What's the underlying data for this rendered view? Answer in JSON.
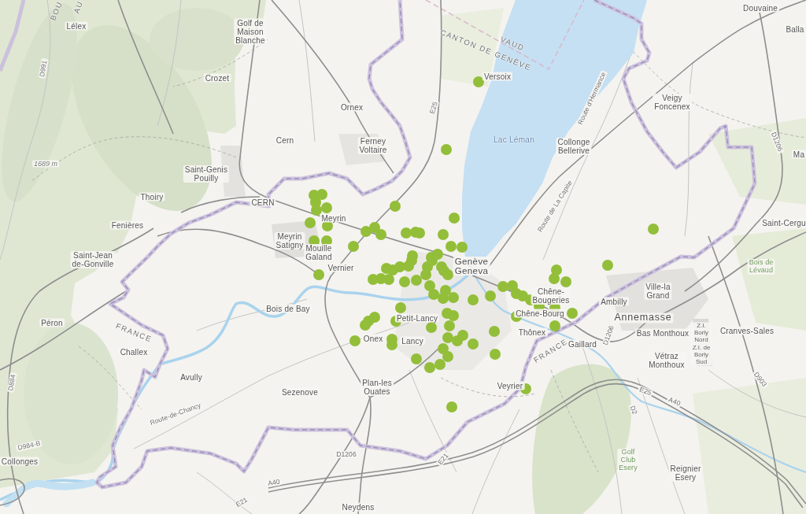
{
  "map": {
    "labels": [
      {
        "kind": "region",
        "lines": [
          "BOU"
        ]
      },
      {
        "kind": "region",
        "lines": [
          "AU"
        ]
      },
      {
        "kind": "place",
        "lines": [
          "Douvaine"
        ]
      },
      {
        "kind": "place",
        "lines": [
          "Lélex"
        ]
      },
      {
        "kind": "place",
        "lines": [
          "Golf de",
          "Maison",
          "Blanche"
        ]
      },
      {
        "kind": "place",
        "lines": [
          "Balla"
        ]
      },
      {
        "kind": "region",
        "lines": [
          "CANTON DE GENÈVE"
        ]
      },
      {
        "kind": "region",
        "lines": [
          "VAUD"
        ]
      },
      {
        "kind": "road",
        "lines": [
          "D991"
        ]
      },
      {
        "kind": "place",
        "lines": [
          "Crozet"
        ]
      },
      {
        "kind": "place",
        "lines": [
          "Versoix"
        ]
      },
      {
        "kind": "place",
        "lines": [
          "Ornex"
        ]
      },
      {
        "kind": "road",
        "lines": [
          "E25"
        ]
      },
      {
        "kind": "road",
        "lines": [
          "Route d'Hermance"
        ]
      },
      {
        "kind": "place",
        "lines": [
          "Veigy",
          "Foncenex"
        ]
      },
      {
        "kind": "place",
        "lines": [
          "Cern"
        ]
      },
      {
        "kind": "place",
        "lines": [
          "Ferney",
          "Voltaire"
        ]
      },
      {
        "kind": "water",
        "lines": [
          "Lac Léman"
        ]
      },
      {
        "kind": "place",
        "lines": [
          "Collonge",
          "Bellerive"
        ]
      },
      {
        "kind": "road",
        "lines": [
          "D1206"
        ]
      },
      {
        "kind": "place",
        "lines": [
          "Ma"
        ]
      },
      {
        "kind": "elevation",
        "lines": [
          "1689 m"
        ]
      },
      {
        "kind": "place",
        "lines": [
          "Saint-Genis",
          "Pouilly"
        ]
      },
      {
        "kind": "place",
        "lines": [
          "Thoiry"
        ]
      },
      {
        "kind": "place",
        "lines": [
          "CERN"
        ]
      },
      {
        "kind": "road",
        "lines": [
          "Route de La Capite"
        ]
      },
      {
        "kind": "place",
        "lines": [
          "Fenières"
        ]
      },
      {
        "kind": "place",
        "lines": [
          "Meyrin"
        ]
      },
      {
        "kind": "place",
        "lines": [
          "Saint-Cergu"
        ]
      },
      {
        "kind": "place",
        "lines": [
          "Meyrin",
          "Satigny"
        ]
      },
      {
        "kind": "place",
        "lines": [
          "Mouille",
          "Galand"
        ]
      },
      {
        "kind": "place",
        "lines": [
          "Saint-Jean",
          "de-Gonville"
        ]
      },
      {
        "kind": "place",
        "lines": [
          "Vernier"
        ]
      },
      {
        "kind": "town",
        "lines": [
          "Genève",
          "Geneva"
        ]
      },
      {
        "kind": "park",
        "lines": [
          "Bois de",
          "Lévaud"
        ]
      },
      {
        "kind": "place",
        "lines": [
          "Chêne-",
          "Bougeries"
        ]
      },
      {
        "kind": "place",
        "lines": [
          "Ambilly"
        ]
      },
      {
        "kind": "place",
        "lines": [
          "Ville-la",
          "Grand"
        ]
      },
      {
        "kind": "place",
        "lines": [
          "Péron"
        ]
      },
      {
        "kind": "place",
        "lines": [
          "Bois de Bay"
        ]
      },
      {
        "kind": "place",
        "lines": [
          "Petit-Lancy"
        ]
      },
      {
        "kind": "place",
        "lines": [
          "Chêne-Bourg"
        ]
      },
      {
        "kind": "city",
        "lines": [
          "Annemasse"
        ]
      },
      {
        "kind": "region",
        "lines": [
          "FRANCE"
        ]
      },
      {
        "kind": "place",
        "lines": [
          "Onex"
        ]
      },
      {
        "kind": "place",
        "lines": [
          "Lancy"
        ]
      },
      {
        "kind": "place",
        "lines": [
          "Thônex"
        ]
      },
      {
        "kind": "place",
        "lines": [
          "Gaillard"
        ]
      },
      {
        "kind": "road",
        "lines": [
          "D1206"
        ]
      },
      {
        "kind": "place",
        "lines": [
          "Bas Monthoux"
        ]
      },
      {
        "kind": "small",
        "lines": [
          "Z.I.",
          "Borly",
          "Nord",
          "Z.I. de",
          "Borly",
          "Sud"
        ]
      },
      {
        "kind": "place",
        "lines": [
          "Cranves-Sales"
        ]
      },
      {
        "kind": "place",
        "lines": [
          "Challex"
        ]
      },
      {
        "kind": "region",
        "lines": [
          "FRANCE"
        ]
      },
      {
        "kind": "place",
        "lines": [
          "Vétraz",
          "Monthoux"
        ]
      },
      {
        "kind": "road",
        "lines": [
          "D884"
        ]
      },
      {
        "kind": "place",
        "lines": [
          "Avully"
        ]
      },
      {
        "kind": "place",
        "lines": [
          "Sezenove"
        ]
      },
      {
        "kind": "place",
        "lines": [
          "Plan-les",
          "Ouates"
        ]
      },
      {
        "kind": "place",
        "lines": [
          "Veyrier"
        ]
      },
      {
        "kind": "road",
        "lines": [
          "E25"
        ]
      },
      {
        "kind": "road",
        "lines": [
          "D903"
        ]
      },
      {
        "kind": "road",
        "lines": [
          "Route-de-Chancy"
        ]
      },
      {
        "kind": "road",
        "lines": [
          "D2"
        ]
      },
      {
        "kind": "road",
        "lines": [
          "A40"
        ]
      },
      {
        "kind": "road",
        "lines": [
          "D984-B"
        ]
      },
      {
        "kind": "place",
        "lines": [
          "Collonges"
        ]
      },
      {
        "kind": "road",
        "lines": [
          "D1206"
        ]
      },
      {
        "kind": "road",
        "lines": [
          "E21"
        ]
      },
      {
        "kind": "park",
        "lines": [
          "Golf",
          "Club",
          "Esery"
        ]
      },
      {
        "kind": "road",
        "lines": [
          "A40"
        ]
      },
      {
        "kind": "place",
        "lines": [
          "Reignier",
          "Esery"
        ]
      },
      {
        "kind": "road",
        "lines": [
          "E21"
        ]
      },
      {
        "kind": "place",
        "lines": [
          "Neydens"
        ]
      }
    ]
  }
}
